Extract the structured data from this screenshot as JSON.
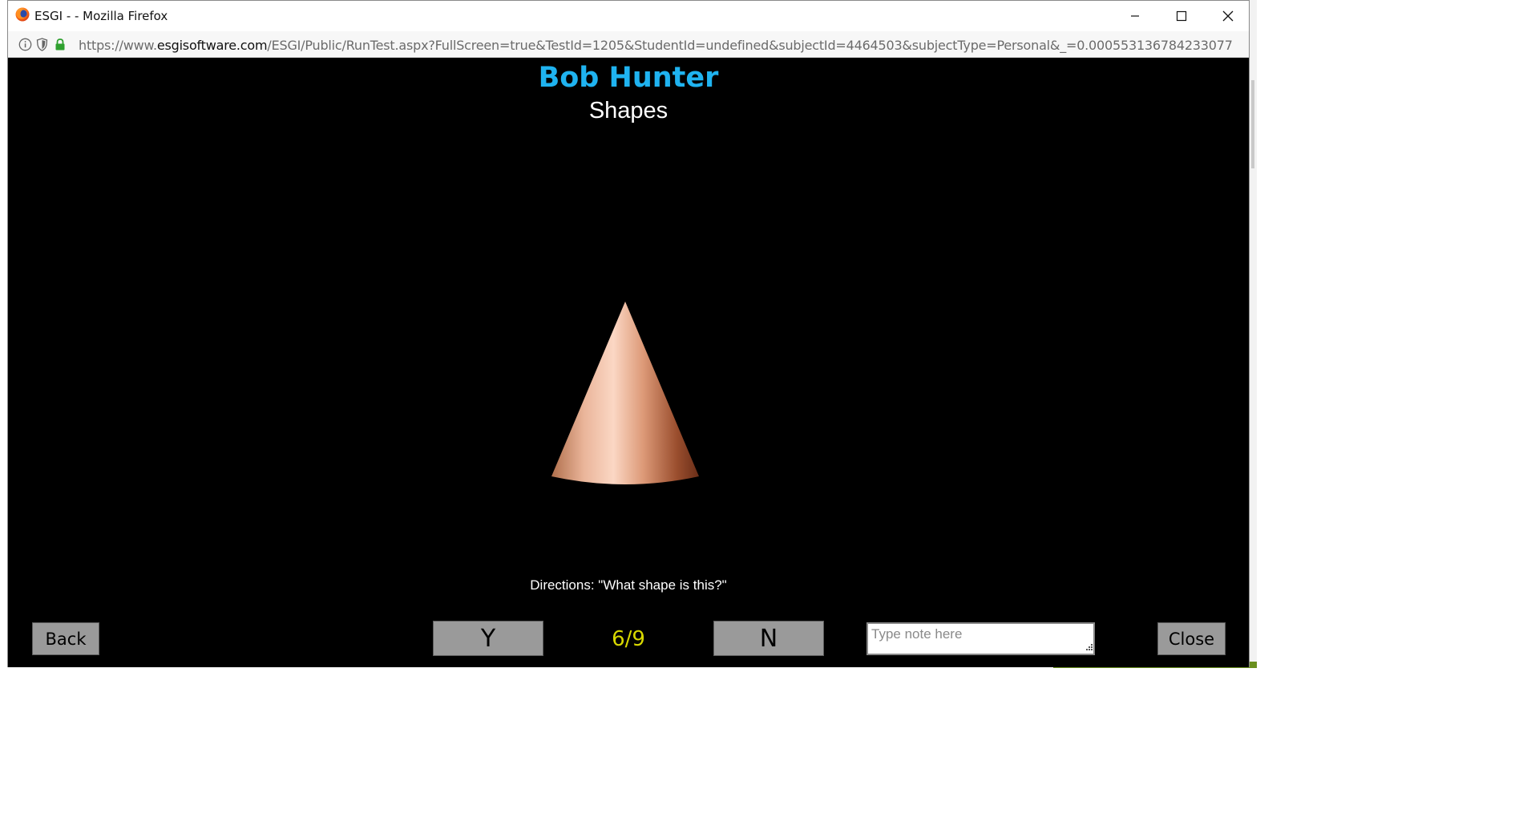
{
  "window": {
    "title": "ESGI - - Mozilla Firefox",
    "url_prefix": "https://www.",
    "url_domain": "esgisoftware.com",
    "url_path": "/ESGI/Public/RunTest.aspx?FullScreen=true&TestId=1205&StudentId=undefined&subjectId=4464503&subjectType=Personal&_=0.000553136784233077"
  },
  "test": {
    "student_name": "Bob Hunter",
    "subject_name": "Shapes",
    "directions": "Directions: \"What shape is this?\"",
    "progress": "6/9",
    "item_image": "cone-shape"
  },
  "controls": {
    "back_label": "Back",
    "yes_label": "Y",
    "no_label": "N",
    "close_label": "Close",
    "note_placeholder": "Type note here",
    "note_value": ""
  },
  "colors": {
    "student_name": "#1fb3f0",
    "progress": "#d8d800",
    "stage_background": "#000000",
    "button_background": "#9a9a9a"
  },
  "icons": {
    "browser": "firefox-logo-icon",
    "info": "info-icon",
    "tracking": "shield-icon",
    "secure": "lock-icon",
    "minimize": "minimize-icon",
    "maximize": "maximize-icon",
    "close": "close-icon",
    "resize": "resize-grip-icon"
  }
}
